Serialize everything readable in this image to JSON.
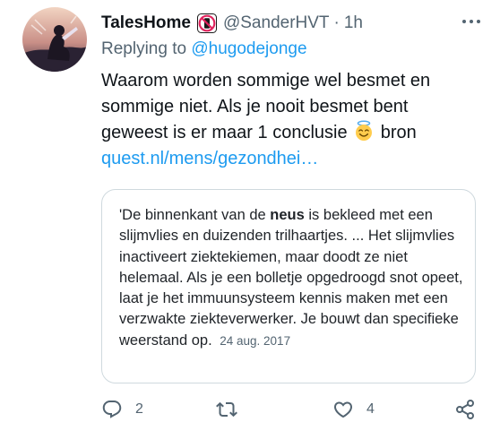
{
  "tweet": {
    "display_name": "TalesHome",
    "badge_icon": "no-phone-badge-icon",
    "handle": "@SanderHVT",
    "separator": "·",
    "time": "1h",
    "reply_prefix": "Replying to",
    "reply_to": "@hugodejonge",
    "text_main": "Waarom worden sommige wel besmet en sommige niet. Als je nooit besmet bent geweest is er maar 1 conclusie",
    "text_emoji": "smiling-face-with-halo",
    "text_after_emoji": "bron",
    "link": "quest.nl/mens/gezondhei…"
  },
  "quote": {
    "text_start": "'De binnenkant van de",
    "text_bold": "neus",
    "text_rest": "is bekleed met een slijmvlies en duizenden trilhaartjes. ... Het slijmvlies inactiveert ziektekiemen, maar doodt ze niet helemaal. Als je een bolletje opgedroogd snot opeet, laat je het immuunsysteem kennis maken met een verzwakte ziekteverwerker. Je bouwt dan specifieke weerstand op.",
    "date": "24 aug. 2017"
  },
  "actions": {
    "reply_count": "2",
    "retweet_count": "",
    "like_count": "4"
  },
  "colors": {
    "link": "#1d9bf0",
    "secondary": "#536471",
    "border": "#cfd9de"
  }
}
